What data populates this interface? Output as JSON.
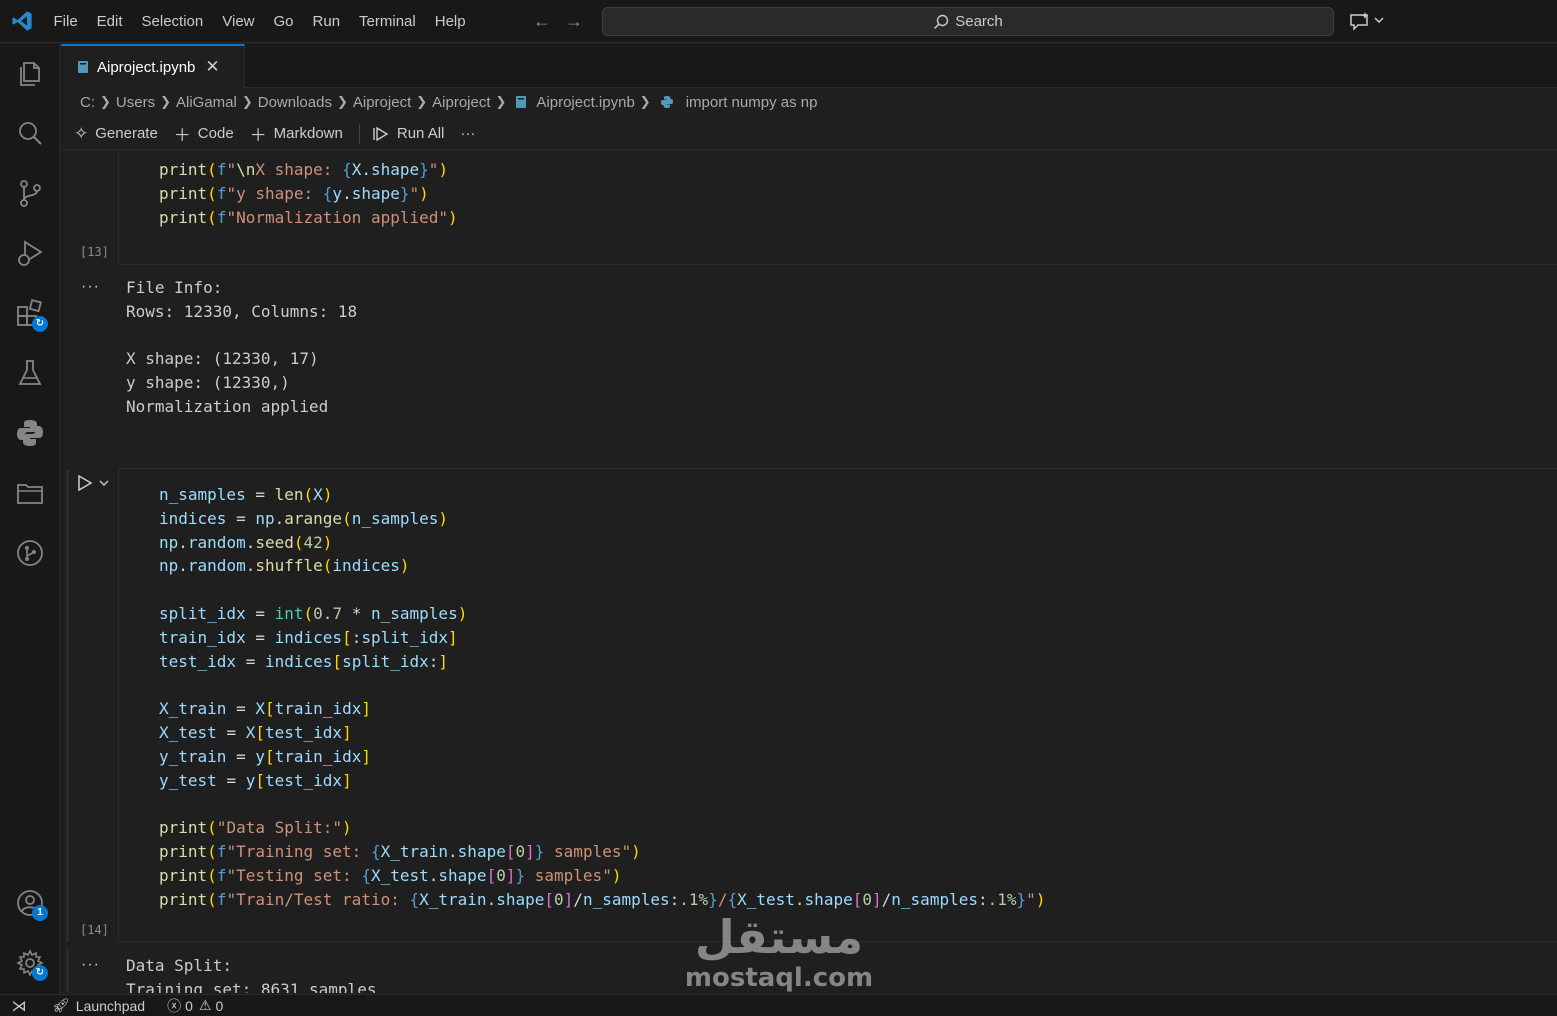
{
  "menu": [
    "File",
    "Edit",
    "Selection",
    "View",
    "Go",
    "Run",
    "Terminal",
    "Help"
  ],
  "search": {
    "label": "Search"
  },
  "tab": {
    "label": "Aiproject.ipynb",
    "close_glyph": "✕"
  },
  "breadcrumb": [
    "C:",
    "Users",
    "AliGamal",
    "Downloads",
    "Aiproject",
    "Aiproject",
    "Aiproject.ipynb",
    "import numpy as np"
  ],
  "toolbar": {
    "generate": "Generate",
    "code": "Code",
    "markdown": "Markdown",
    "run_all": "Run All",
    "more": "···"
  },
  "cells": [
    {
      "exec_count": "[13]",
      "output": "File Info:\nRows: 12330, Columns: 18\n\nX shape: (12330, 17)\ny shape: (12330,)\nNormalization applied"
    },
    {
      "exec_count": "[14]",
      "output": "Data Split:\nTraining set: 8631 samples"
    }
  ],
  "output_dots": "···",
  "statusbar": {
    "launchpad": "Launchpad",
    "errors": "0",
    "warnings": "0"
  },
  "badges": {
    "extensions": "↻",
    "accounts": "1",
    "settings": "↻"
  },
  "watermark": {
    "arabic": "مستقل",
    "latin": "mostaql.com"
  },
  "colors": {
    "accent": "#0078d4",
    "background": "#1f1f1f",
    "sidebar": "#181818"
  }
}
